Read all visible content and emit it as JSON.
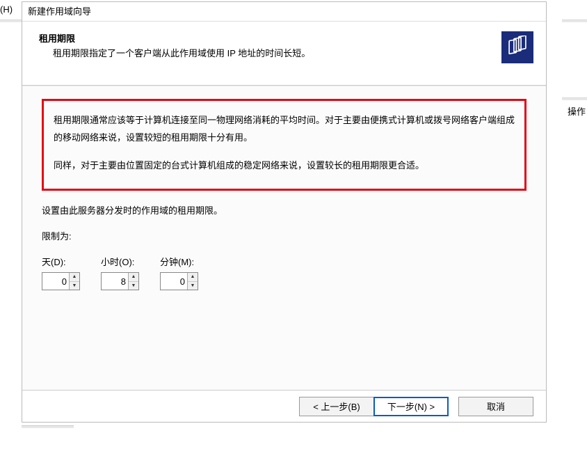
{
  "menu_h": "(H)",
  "side_text": "操作",
  "wizard": {
    "title": "新建作用域向导",
    "header": {
      "title": "租用期限",
      "desc": "租用期限指定了一个客户端从此作用域使用 IP 地址的时间长短。",
      "icon_name": "scope-icon"
    },
    "content": {
      "highlight_p1": "租用期限通常应该等于计算机连接至同一物理网络消耗的平均时间。对于主要由便携式计算机或拨号网络客户端组成的移动网络来说，设置较短的租用期限十分有用。",
      "highlight_p2": "同样，对于主要由位置固定的台式计算机组成的稳定网络来说，设置较长的租用期限更合适。",
      "info_line": "设置由此服务器分发时的作用域的租用期限。",
      "limit_label": "限制为:",
      "spinners": {
        "days": {
          "label": "天(D):",
          "value": "0"
        },
        "hours": {
          "label": "小时(O):",
          "value": "8"
        },
        "minutes": {
          "label": "分钟(M):",
          "value": "0"
        }
      }
    },
    "footer": {
      "back": "< 上一步(B)",
      "next": "下一步(N) >",
      "cancel": "取消"
    }
  }
}
